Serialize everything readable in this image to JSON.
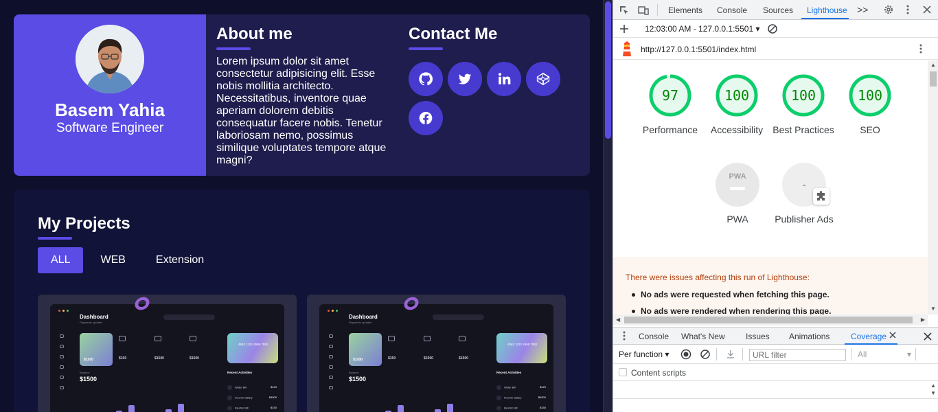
{
  "profile": {
    "name": "Basem Yahia",
    "role": "Software Engineer"
  },
  "about": {
    "title": "About me",
    "text": "Lorem ipsum dolor sit amet consectetur adipisicing elit. Esse nobis mollitia architecto. Necessitatibus, inventore quae aperiam dolorem debitis consequatur facere nobis. Tenetur laboriosam nemo, possimus similique voluptates tempore atque magni?"
  },
  "contact": {
    "title": "Contact Me",
    "icons": [
      "github-icon",
      "twitter-icon",
      "linkedin-icon",
      "codepen-icon",
      "facebook-icon"
    ]
  },
  "projects": {
    "title": "My Projects",
    "filters": [
      "ALL",
      "WEB",
      "Extension"
    ],
    "active_filter": "ALL",
    "card_preview": {
      "title": "Dashboard",
      "subtitle": "Payments updates",
      "search": "Search",
      "stats": [
        "$1200",
        "$150",
        "$1500",
        "$1500"
      ],
      "card_number": "4562 1122 4595 7852",
      "balance_label": "Balance",
      "balance": "$1500",
      "recent_title": "Recent Activities",
      "recent": [
        {
          "label": "Water Bill",
          "value": "$120"
        },
        {
          "label": "Income Salary",
          "value": "$4500"
        },
        {
          "label": "Electric Bill",
          "value": "$150"
        }
      ]
    }
  },
  "devtools": {
    "tabs": [
      "Elements",
      "Console",
      "Sources",
      "Lighthouse"
    ],
    "active_tab": "Lighthouse",
    "more": ">>",
    "report_time": "12:03:00 AM - 127.0.0.1:5501",
    "report_url": "http://127.0.0.1:5501/index.html",
    "scores": [
      {
        "label": "Performance",
        "score": "97",
        "value": 97
      },
      {
        "label": "Accessibility",
        "score": "100",
        "value": 100
      },
      {
        "label": "Best Practices",
        "score": "100",
        "value": 100
      },
      {
        "label": "SEO",
        "score": "100",
        "value": 100
      }
    ],
    "extra_categories": [
      {
        "label": "PWA",
        "score": "PWA"
      },
      {
        "label": "Publisher Ads",
        "score": "-"
      }
    ],
    "issues_title": "There were issues affecting this run of Lighthouse:",
    "issues": [
      "No ads were requested when fetching this page.",
      "No ads were rendered when rendering this page."
    ],
    "drawer_tabs": [
      "Console",
      "What's New",
      "Issues",
      "Animations",
      "Coverage"
    ],
    "active_drawer_tab": "Coverage",
    "coverage": {
      "mode": "Per function",
      "url_filter_placeholder": "URL filter",
      "type_filter": "All",
      "content_scripts_label": "Content scripts"
    },
    "colors": {
      "pass": "#0cce6b",
      "pass_bg": "#e6f9ef",
      "accent": "#1a73e8"
    }
  },
  "colors": {
    "brand": "#5a4ce5",
    "card_bg": "#1f1d4d",
    "page_bg": "#0e0f2b"
  }
}
